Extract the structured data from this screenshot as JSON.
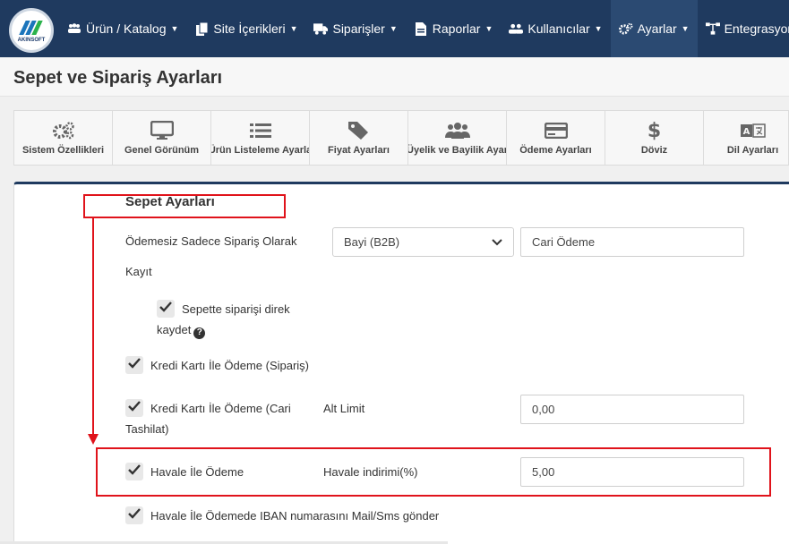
{
  "brand": {
    "logo_text": "AKINSOFT"
  },
  "nav": {
    "items": [
      {
        "label": "Ürün / Katalog",
        "icon": "users-icon"
      },
      {
        "label": "Site İçerikleri",
        "icon": "copy-icon"
      },
      {
        "label": "Siparişler",
        "icon": "truck-icon"
      },
      {
        "label": "Raporlar",
        "icon": "file-icon"
      },
      {
        "label": "Kullanıcılar",
        "icon": "users-icon"
      },
      {
        "label": "Ayarlar",
        "icon": "gears-icon"
      },
      {
        "label": "Entegrasyonlar",
        "icon": "sitemap-icon"
      }
    ],
    "active": "Ayarlar"
  },
  "page": {
    "title": "Sepet ve Sipariş Ayarları"
  },
  "tabs": [
    {
      "label": "Sistem Özellikleri",
      "icon": "gears-icon"
    },
    {
      "label": "Genel Görünüm",
      "icon": "monitor-icon"
    },
    {
      "label": "Ürün Listeleme Ayarla",
      "icon": "list-icon"
    },
    {
      "label": "Fiyat Ayarları",
      "icon": "tags-icon"
    },
    {
      "label": "Üyelik ve Bayilik Ayar",
      "icon": "users-icon"
    },
    {
      "label": "Ödeme Ayarları",
      "icon": "credit-card-icon"
    },
    {
      "label": "Döviz",
      "icon": "dollar-icon"
    },
    {
      "label": "Dil Ayarları",
      "icon": "language-icon"
    }
  ],
  "form": {
    "section_title": "Sepet Ayarları",
    "unpaid_label_line1": "Ödemesiz Sadece Sipariş Olarak",
    "unpaid_label_line2": "Kayıt",
    "unpaid_select": "Bayi (B2B)",
    "unpaid_input": "Cari Ödeme",
    "direct_save_line1": "Sepette siparişi direk",
    "direct_save_line2": "kaydet",
    "direct_save_checked": true,
    "cc_order_label": "Kredi Kartı İle Ödeme (Sipariş)",
    "cc_order_checked": true,
    "cc_cari_line1": "Kredi Kartı İle Ödeme (Cari",
    "cc_cari_line2": "Tashilat)",
    "cc_cari_checked": true,
    "alt_limit_label": "Alt Limit",
    "alt_limit_value": "0,00",
    "havale_label": "Havale İle Ödeme",
    "havale_checked": true,
    "havale_discount_label": "Havale indirimi(%)",
    "havale_discount_value": "5,00",
    "iban_label": "Havale İle Ödemede IBAN numarasını Mail/Sms gönder",
    "iban_checked": true
  },
  "colors": {
    "nav_bg": "#1f3a5f",
    "highlight": "#e0131b"
  }
}
